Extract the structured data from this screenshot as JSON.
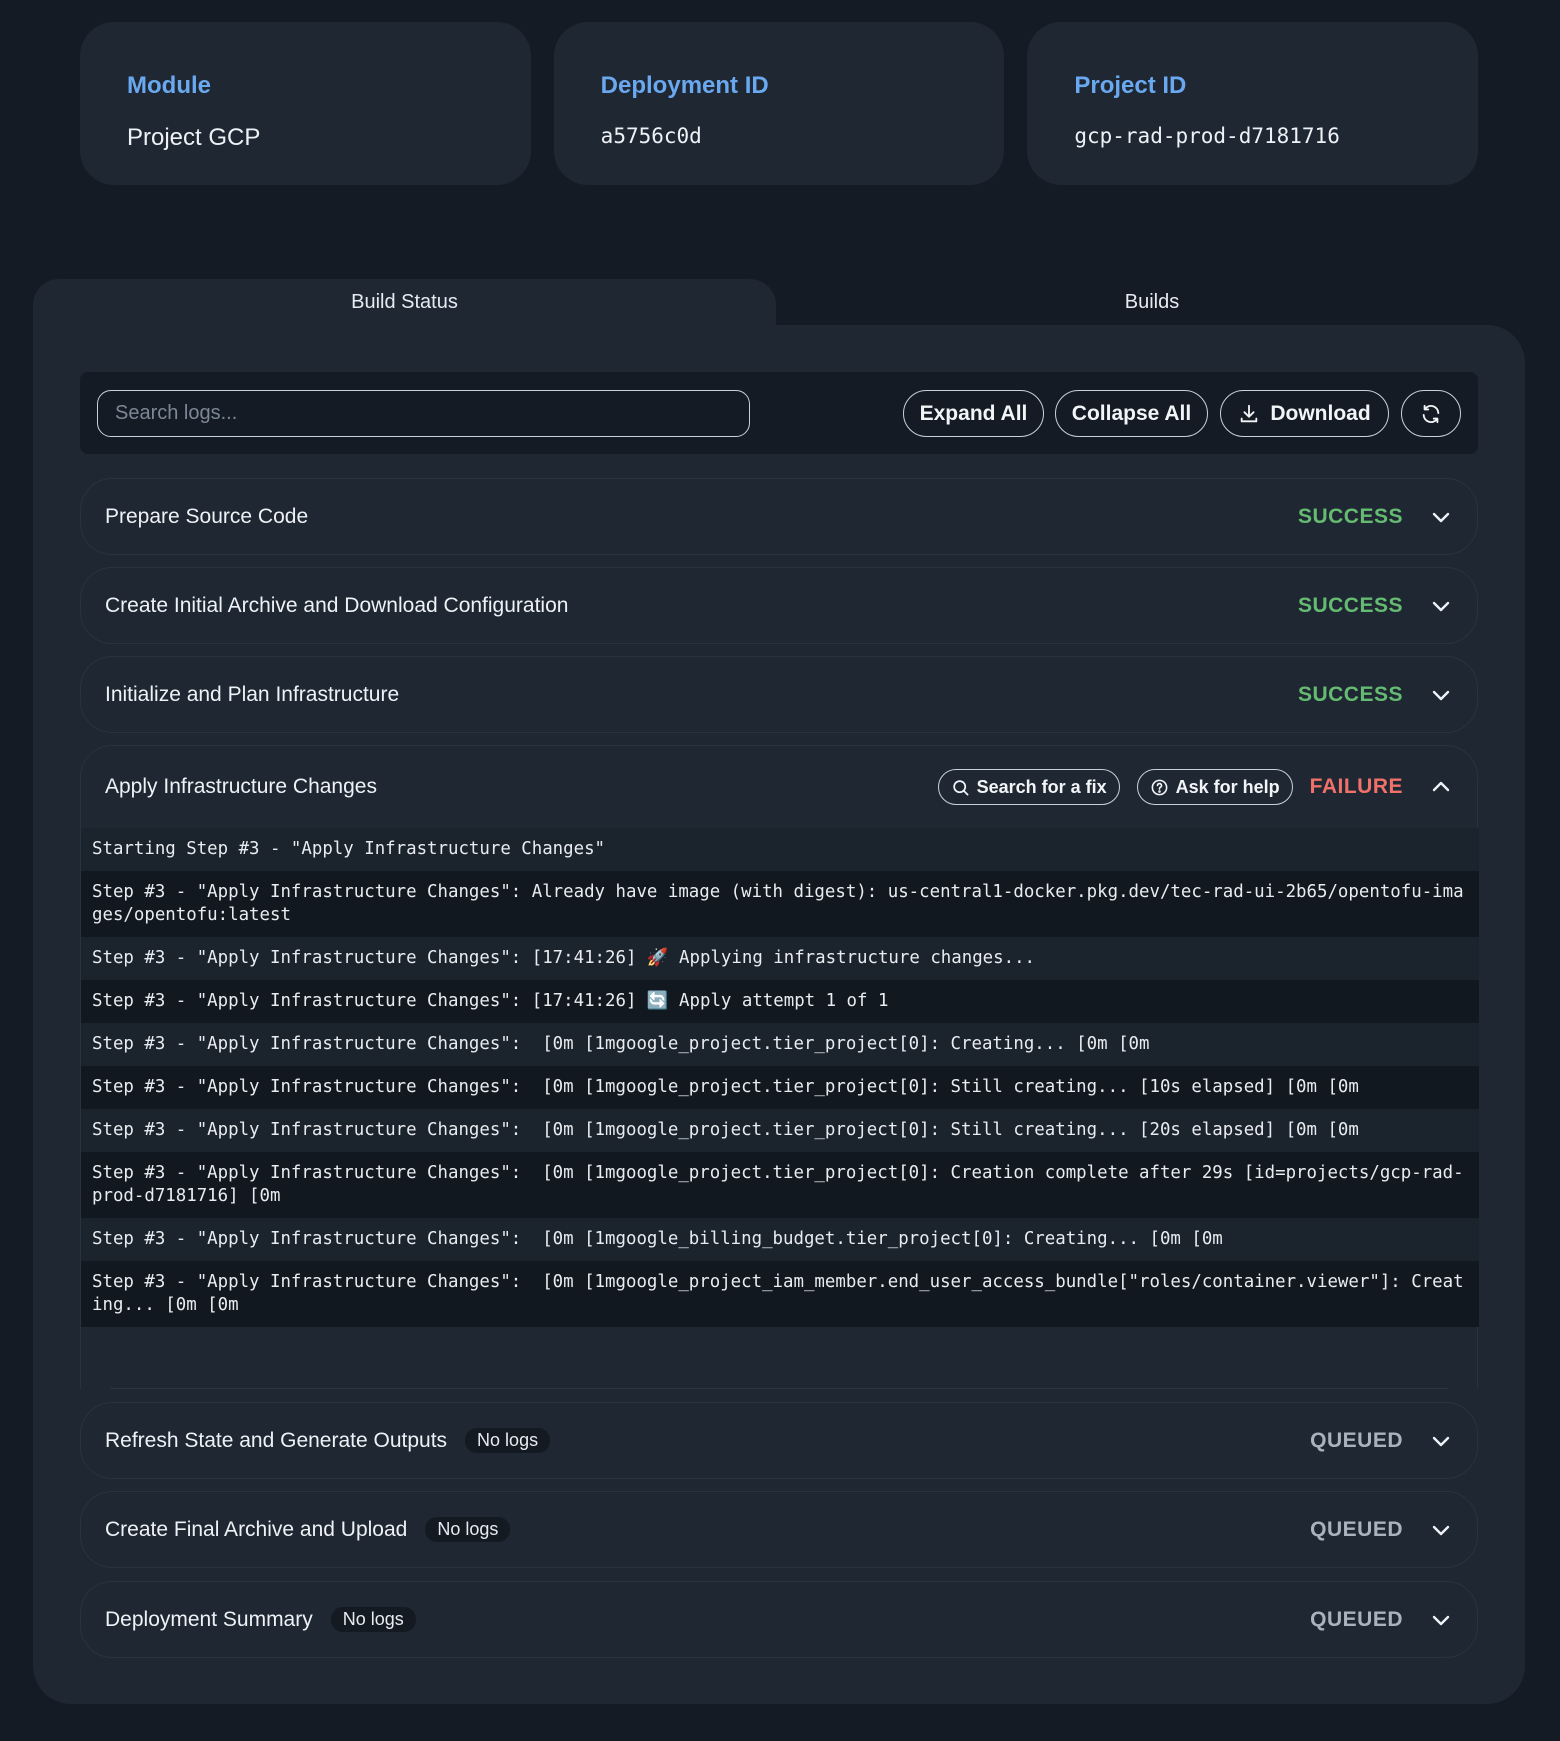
{
  "cards": [
    {
      "label": "Module",
      "value": "Project GCP"
    },
    {
      "label": "Deployment ID",
      "value": "a5756c0d"
    },
    {
      "label": "Project ID",
      "value": "gcp-rad-prod-d7181716"
    }
  ],
  "tabs": {
    "build_status": "Build Status",
    "builds": "Builds"
  },
  "toolbar": {
    "search_placeholder": "Search logs...",
    "expand_all": "Expand All",
    "collapse_all": "Collapse All",
    "download": "Download"
  },
  "steps_top": [
    {
      "title": "Prepare Source Code",
      "status": "SUCCESS"
    },
    {
      "title": "Create Initial Archive and Download Configuration",
      "status": "SUCCESS"
    },
    {
      "title": "Initialize and Plan Infrastructure",
      "status": "SUCCESS"
    }
  ],
  "open_step": {
    "title": "Apply Infrastructure Changes",
    "search_fix": "Search for a fix",
    "ask_help": "Ask for help",
    "status": "FAILURE",
    "logs": [
      "Starting Step #3 - \"Apply Infrastructure Changes\"",
      "Step #3 - \"Apply Infrastructure Changes\": Already have image (with digest): us-central1-docker.pkg.dev/tec-rad-ui-2b65/opentofu-images/opentofu:latest",
      "Step #3 - \"Apply Infrastructure Changes\": [17:41:26] 🚀 Applying infrastructure changes...",
      "Step #3 - \"Apply Infrastructure Changes\": [17:41:26] 🔄 Apply attempt 1 of 1",
      "Step #3 - \"Apply Infrastructure Changes\":  [0m [1mgoogle_project.tier_project[0]: Creating... [0m [0m",
      "Step #3 - \"Apply Infrastructure Changes\":  [0m [1mgoogle_project.tier_project[0]: Still creating... [10s elapsed] [0m [0m",
      "Step #3 - \"Apply Infrastructure Changes\":  [0m [1mgoogle_project.tier_project[0]: Still creating... [20s elapsed] [0m [0m",
      "Step #3 - \"Apply Infrastructure Changes\":  [0m [1mgoogle_project.tier_project[0]: Creation complete after 29s [id=projects/gcp-rad-prod-d7181716] [0m",
      "Step #3 - \"Apply Infrastructure Changes\":  [0m [1mgoogle_billing_budget.tier_project[0]: Creating... [0m [0m",
      "Step #3 - \"Apply Infrastructure Changes\":  [0m [1mgoogle_project_iam_member.end_user_access_bundle[\"roles/container.viewer\"]: Creating... [0m [0m"
    ]
  },
  "steps_bottom": [
    {
      "title": "Refresh State and Generate Outputs",
      "badge": "No logs",
      "status": "QUEUED"
    },
    {
      "title": "Create Final Archive and Upload",
      "badge": "No logs",
      "status": "QUEUED"
    },
    {
      "title": "Deployment Summary",
      "badge": "No logs",
      "status": "QUEUED"
    }
  ],
  "colors": {
    "success": "#66bb72",
    "failure": "#f0706a",
    "queued": "#a9b3be",
    "accent": "#6aa8ef"
  }
}
